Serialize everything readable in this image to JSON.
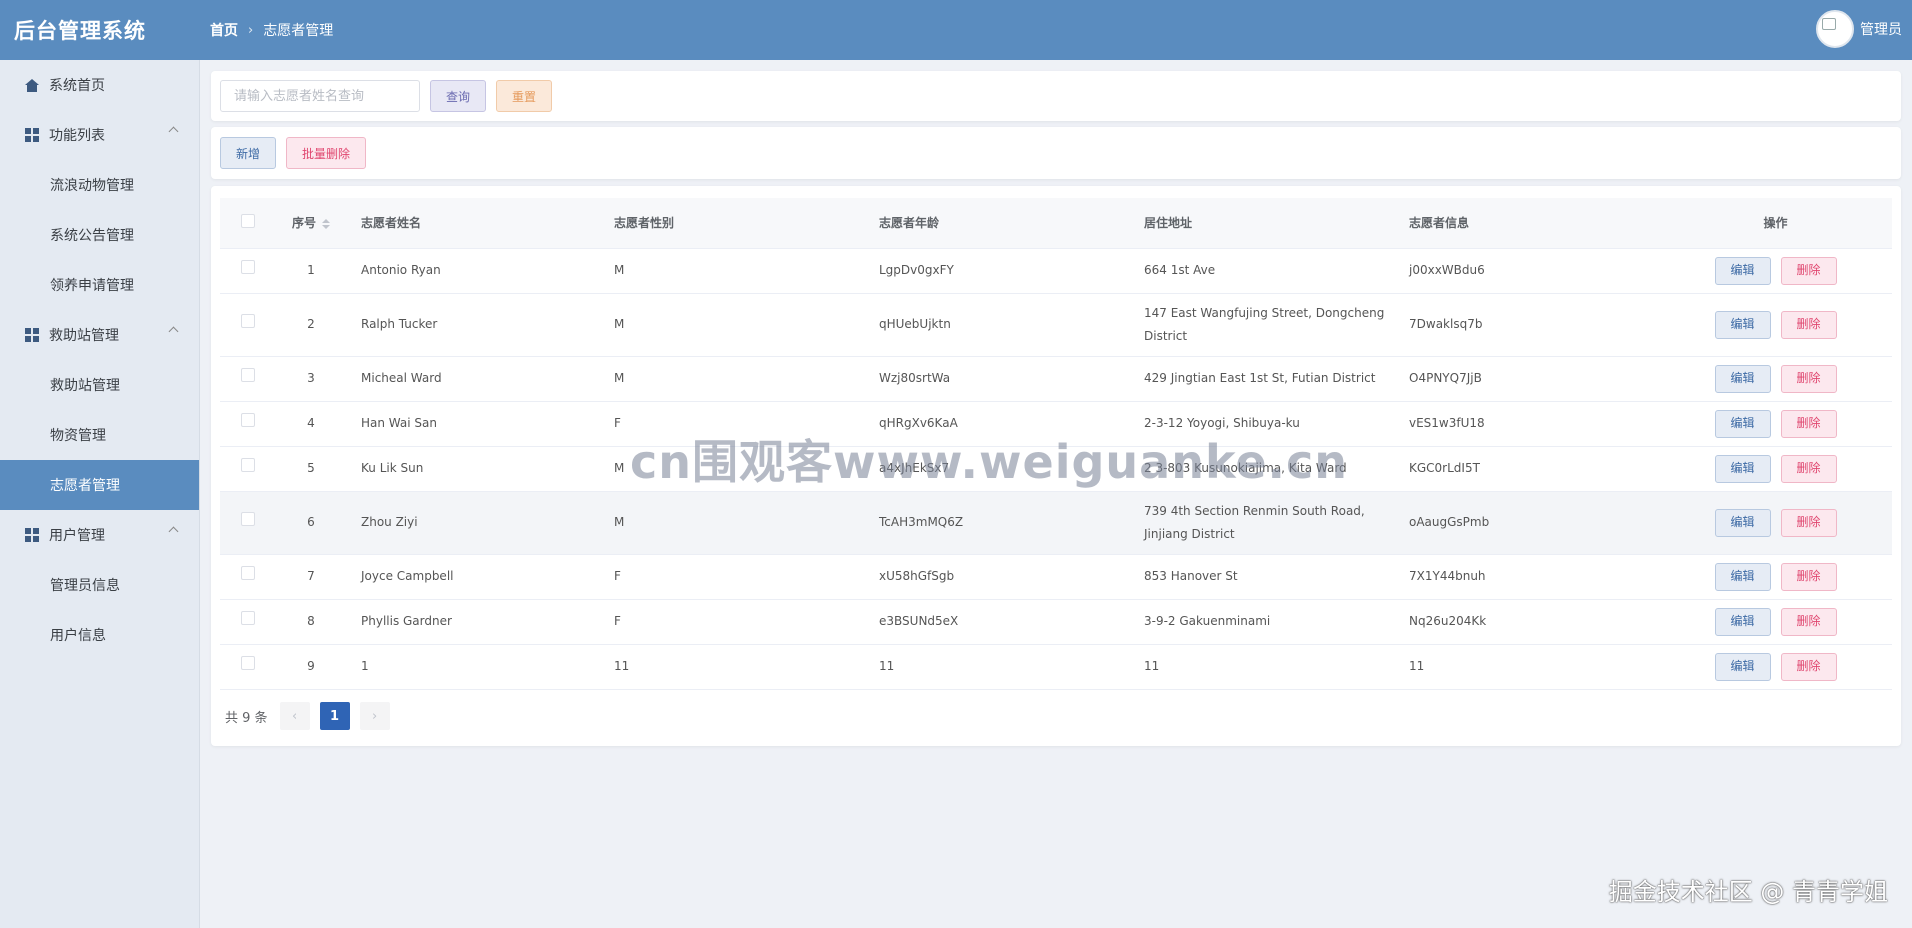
{
  "header": {
    "logo": "后台管理系统",
    "breadcrumb": [
      "首页",
      "志愿者管理"
    ],
    "breadcrumb_sep": "›",
    "user_name": "管理员"
  },
  "sidebar": {
    "items": [
      {
        "label": "系统首页",
        "icon": "home-icon",
        "level": 1
      },
      {
        "label": "功能列表",
        "icon": "grid-icon",
        "level": 1,
        "expanded": true
      },
      {
        "label": "流浪动物管理",
        "level": 2
      },
      {
        "label": "系统公告管理",
        "level": 2
      },
      {
        "label": "领养申请管理",
        "level": 2
      },
      {
        "label": "救助站管理",
        "icon": "grid-icon",
        "level": 1,
        "expanded": true
      },
      {
        "label": "救助站管理",
        "level": 2
      },
      {
        "label": "物资管理",
        "level": 2
      },
      {
        "label": "志愿者管理",
        "level": 2,
        "active": true
      },
      {
        "label": "用户管理",
        "icon": "grid-icon",
        "level": 1,
        "expanded": true
      },
      {
        "label": "管理员信息",
        "level": 2
      },
      {
        "label": "用户信息",
        "level": 2
      }
    ]
  },
  "search": {
    "placeholder": "请输入志愿者姓名查询",
    "value": "",
    "query_label": "查询",
    "reset_label": "重置"
  },
  "actions": {
    "add_label": "新增",
    "batch_delete_label": "批量删除"
  },
  "table": {
    "columns": [
      "序号",
      "志愿者姓名",
      "志愿者性别",
      "志愿者年龄",
      "居住地址",
      "志愿者信息",
      "操作"
    ],
    "edit_label": "编辑",
    "delete_label": "删除",
    "rows": [
      {
        "no": "1",
        "name": "Antonio Ryan",
        "gender": "M",
        "age": "LgpDv0gxFY",
        "address": "664 1st Ave",
        "info": "j00xxWBdu6"
      },
      {
        "no": "2",
        "name": "Ralph Tucker",
        "gender": "M",
        "age": "qHUebUjktn",
        "address": "147 East Wangfujing Street, Dongcheng District",
        "info": "7Dwaklsq7b"
      },
      {
        "no": "3",
        "name": "Micheal Ward",
        "gender": "M",
        "age": "Wzj80srtWa",
        "address": "429 Jingtian East 1st St, Futian District",
        "info": "O4PNYQ7JjB"
      },
      {
        "no": "4",
        "name": "Han Wai San",
        "gender": "F",
        "age": "qHRgXv6KaA",
        "address": "2-3-12 Yoyogi, Shibuya-ku",
        "info": "vES1w3fU18"
      },
      {
        "no": "5",
        "name": "Ku Lik Sun",
        "gender": "M",
        "age": "a4xJhEkSx7",
        "address": "2 3-803 Kusunokiajima, Kita Ward",
        "info": "KGC0rLdI5T"
      },
      {
        "no": "6",
        "name": "Zhou Ziyi",
        "gender": "M",
        "age": "TcAH3mMQ6Z",
        "address": "739 4th Section Renmin South Road, Jinjiang District",
        "info": "oAaugGsPmb"
      },
      {
        "no": "7",
        "name": "Joyce Campbell",
        "gender": "F",
        "age": "xU58hGfSgb",
        "address": "853 Hanover St",
        "info": "7X1Y44bnuh"
      },
      {
        "no": "8",
        "name": "Phyllis Gardner",
        "gender": "F",
        "age": "e3BSUNd5eX",
        "address": "3-9-2 Gakuenminami",
        "info": "Nq26u204Kk"
      },
      {
        "no": "9",
        "name": "1",
        "gender": "11",
        "age": "11",
        "address": "11",
        "info": "11"
      }
    ]
  },
  "pagination": {
    "total_text": "共 9 条",
    "current_page": "1",
    "prev": "‹",
    "next": "›"
  },
  "watermarks": {
    "center": "cn围观客www.weiguanke.cn",
    "corner": "掘金技术社区 @ 青青学姐"
  }
}
